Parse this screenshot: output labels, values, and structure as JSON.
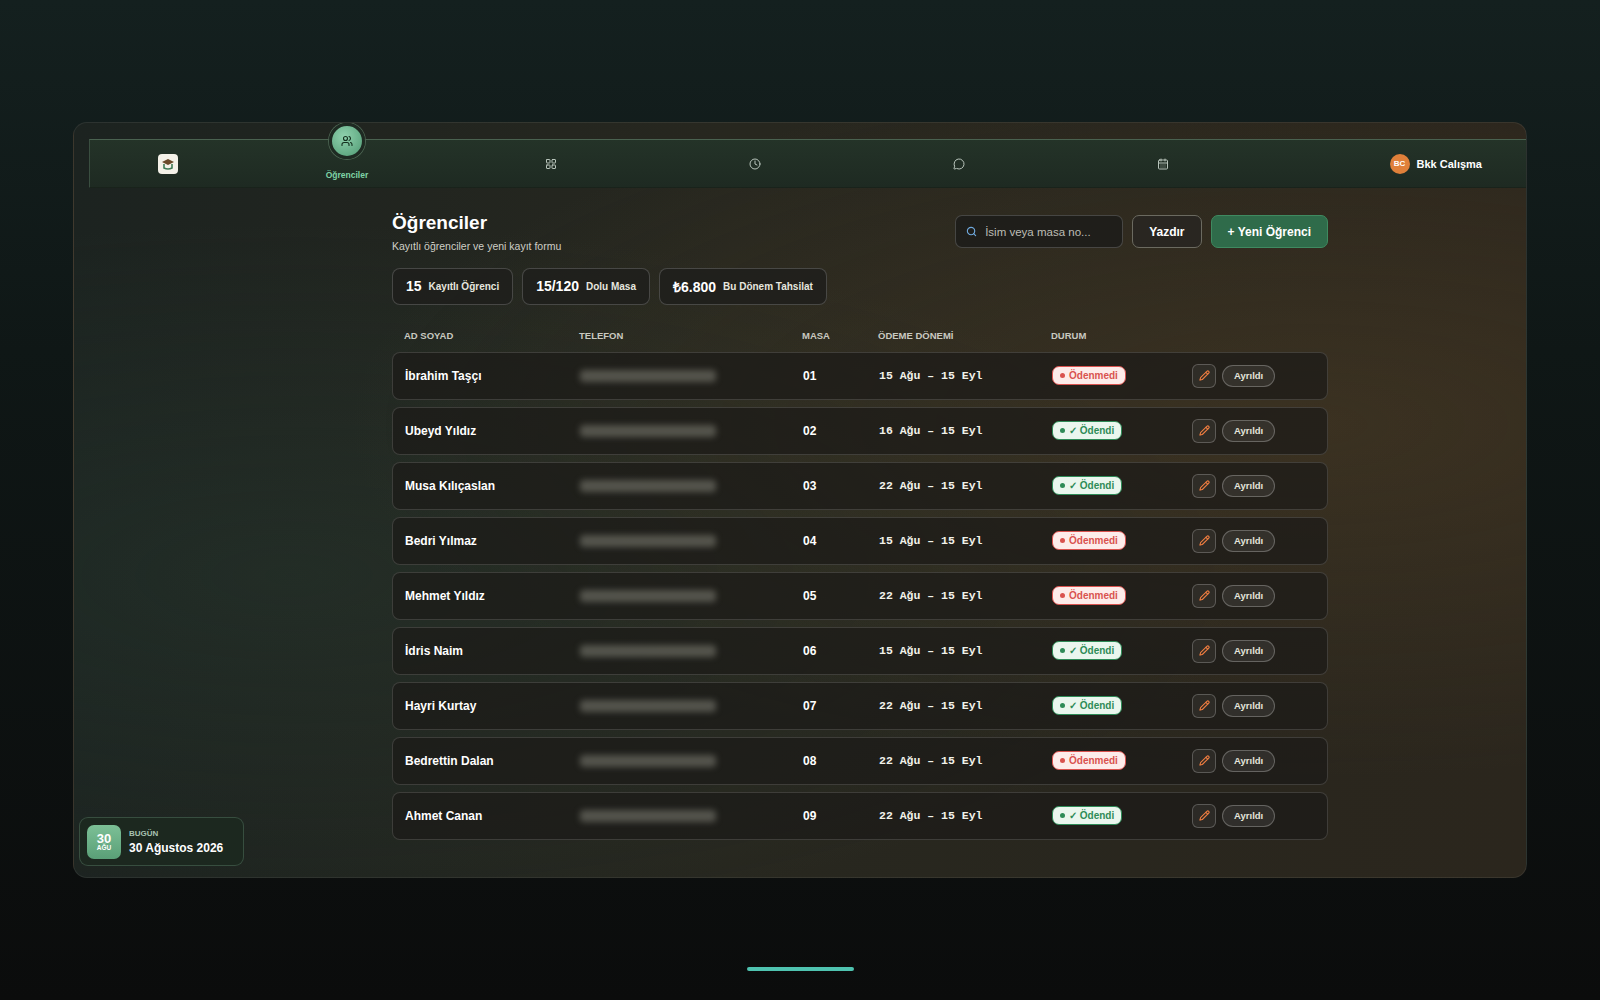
{
  "nav": {
    "items": [
      {
        "label": "Öğrenciler",
        "selected": true
      },
      {
        "selected": false
      },
      {
        "selected": false
      },
      {
        "selected": false
      },
      {
        "selected": false
      }
    ],
    "user": {
      "initials": "BC",
      "name": "Bkk Calışma"
    }
  },
  "page": {
    "title": "Öğrenciler",
    "subtitle": "Kayıtlı öğrenciler ve yeni kayıt formu"
  },
  "search": {
    "placeholder": "İsim veya masa no..."
  },
  "buttons": [
    "Yazdır",
    "+ Yeni Öğrenci"
  ],
  "stats": [
    {
      "value": "15",
      "label": "Kayıtlı Öğrenci"
    },
    {
      "value": "15/120",
      "label": "Dolu Masa"
    },
    {
      "value": "₺6.800",
      "label": "Bu Dönem Tahsilat"
    }
  ],
  "table": {
    "columns": [
      "AD SOYAD",
      "TELEFON",
      "MASA",
      "ÖDEME DÖNEMİ",
      "DURUM"
    ],
    "rows": [
      {
        "name": "İbrahim Taşçı",
        "phone_hidden": true,
        "desk": "01",
        "period": "15 Ağu – 15 Eyl",
        "status": "Ödenmedi",
        "paid": false,
        "color": "#d9534f",
        "action": "Ayrıldı"
      },
      {
        "name": "Ubeyd Yıldız",
        "phone_hidden": true,
        "desk": "02",
        "period": "16 Ağu – 15 Eyl",
        "status": "✓ Ödendi",
        "paid": true,
        "color": "#2e8b57",
        "action": "Ayrıldı"
      },
      {
        "name": "Musa Kılıçaslan",
        "phone_hidden": true,
        "desk": "03",
        "period": "22 Ağu – 15 Eyl",
        "status": "✓ Ödendi",
        "paid": true,
        "color": "#2e8b57",
        "action": "Ayrıldı"
      },
      {
        "name": "Bedri Yılmaz",
        "phone_hidden": true,
        "desk": "04",
        "period": "15 Ağu – 15 Eyl",
        "status": "Ödenmedi",
        "paid": false,
        "color": "#d9534f",
        "action": "Ayrıldı"
      },
      {
        "name": "Mehmet Yıldız",
        "phone_hidden": true,
        "desk": "05",
        "period": "22 Ağu – 15 Eyl",
        "status": "Ödenmedi",
        "paid": false,
        "color": "#d9534f",
        "action": "Ayrıldı"
      },
      {
        "name": "İdris Naim",
        "phone_hidden": true,
        "desk": "06",
        "period": "15 Ağu – 15 Eyl",
        "status": "✓ Ödendi",
        "paid": true,
        "color": "#2e8b57",
        "action": "Ayrıldı"
      },
      {
        "name": "Hayri Kurtay",
        "phone_hidden": true,
        "desk": "07",
        "period": "22 Ağu – 15 Eyl",
        "status": "✓ Ödendi",
        "paid": true,
        "color": "#2e8b57",
        "action": "Ayrıldı"
      },
      {
        "name": "Bedrettin Dalan",
        "phone_hidden": true,
        "desk": "08",
        "period": "22 Ağu – 15 Eyl",
        "status": "Ödenmedi",
        "paid": false,
        "color": "#d9534f",
        "action": "Ayrıldı"
      },
      {
        "name": "Ahmet Canan",
        "phone_hidden": true,
        "desk": "09",
        "period": "22 Ağu – 15 Eyl",
        "status": "✓ Ödendi",
        "paid": true,
        "color": "#2e8b57",
        "action": "Ayrıldı"
      }
    ]
  },
  "today": {
    "day": "30",
    "month": "AĞU",
    "label": "BUGÜN",
    "date": "30 Ağustos 2026"
  }
}
